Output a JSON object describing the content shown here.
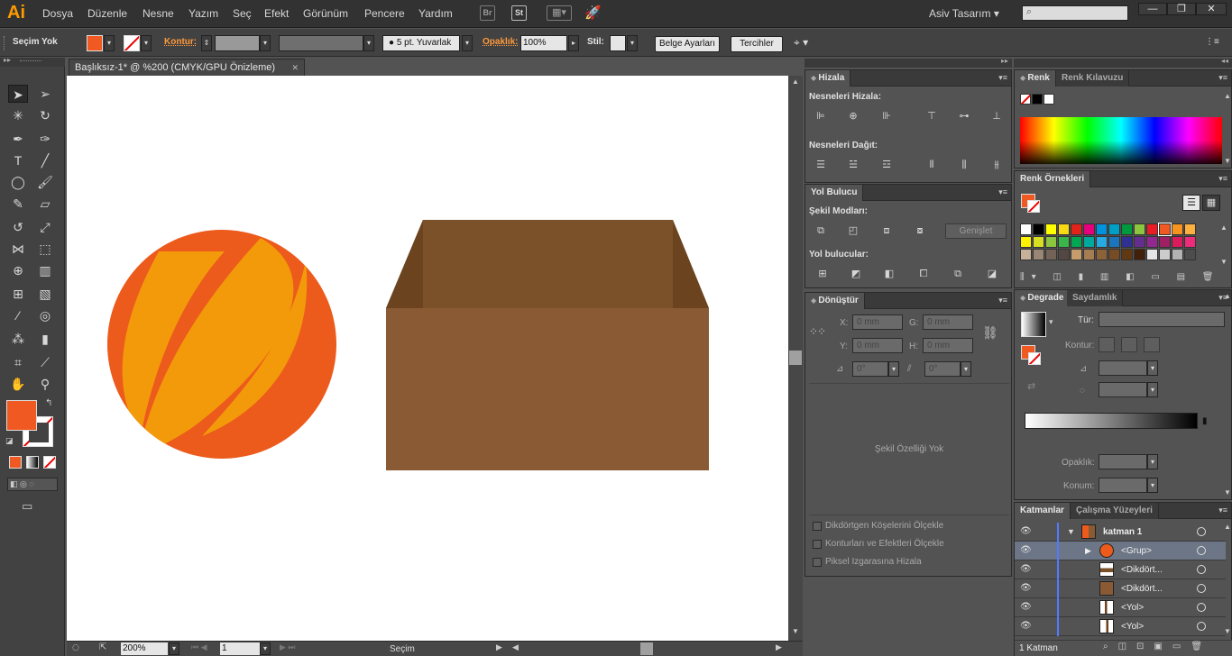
{
  "app": {
    "logo": "Ai"
  },
  "menu": [
    "Dosya",
    "Düzenle",
    "Nesne",
    "Yazım",
    "Seç",
    "Efekt",
    "Görünüm",
    "Pencere",
    "Yardım"
  ],
  "menubar_icons": {
    "bridge": "Br",
    "stock": "St"
  },
  "workspace": {
    "label": "Asiv Tasarım",
    "arrow": "▾"
  },
  "window_buttons": {
    "minimize": "—",
    "restore": "❐",
    "close": "✕"
  },
  "control": {
    "selection": "Seçim Yok",
    "stroke_label": "Kontur:",
    "brush": "5 pt. Yuvarlak",
    "opacity_label": "Opaklık:",
    "opacity": "100%",
    "style_label": "Stil:",
    "doc_setup": "Belge Ayarları",
    "prefs": "Tercihler"
  },
  "colors": {
    "fill": "#f05a22",
    "ball_orange": "#ec5a1c",
    "ball_yellow": "#f39a0a",
    "box_front": "#8a5a34",
    "box_inner": "#7a5128",
    "box_flap": "#6b431f"
  },
  "document": {
    "tab": "Başlıksız-1* @ %200 (CMYK/GPU Önizleme)",
    "close": "✕"
  },
  "status": {
    "zoom": "200%",
    "page": "1",
    "mode": "Seçim"
  },
  "align": {
    "tab": "Hizala",
    "align_objects": "Nesneleri Hizala:",
    "distribute_objects": "Nesneleri Dağıt:"
  },
  "pathfinder": {
    "tab": "Yol Bulucu",
    "shape_modes": "Şekil Modları:",
    "expand": "Genişlet",
    "pathfinders": "Yol bulucular:"
  },
  "transform": {
    "tab": "Dönüştür",
    "x_label": "X:",
    "x": "0 mm",
    "y_label": "Y:",
    "y": "0 mm",
    "g_label": "G:",
    "g": "0 mm",
    "h_label": "H:",
    "h": "0 mm",
    "rot": "0°",
    "shear": "0°",
    "no_props": "Şekil Özelliği Yok",
    "opt1": "Dikdörtgen Köşelerini Ölçekle",
    "opt2": "Konturları ve Efektleri Ölçekle",
    "opt3": "Piksel Izgarasına Hizala"
  },
  "color_panel": {
    "tab": "Renk",
    "tab2": "Renk Kılavuzu"
  },
  "swatches": {
    "tab": "Renk Örnekleri",
    "row1": [
      "#ffffff",
      "#000000",
      "#ffff00",
      "#f7d916",
      "#e2231a",
      "#e6007e",
      "#0093dd",
      "#00a0c6",
      "#009a3e",
      "#8cc63e",
      "#ec1c24",
      "#f05a22",
      "#f7941d",
      "#fbb040"
    ],
    "row2": [
      "#fff200",
      "#d7df23",
      "#8dc63f",
      "#39b54a",
      "#00a651",
      "#00a99d",
      "#27aae1",
      "#1c75bc",
      "#2e3192",
      "#662d91",
      "#92278f",
      "#9e1f63",
      "#da1c5c",
      "#ee2a7b"
    ],
    "row3": [
      "#c7b299",
      "#998675",
      "#736357",
      "#534741",
      "#c69c6d",
      "#a67c52",
      "#8c6239",
      "#754c24",
      "#603913",
      "#42210b",
      "#e6e6e6",
      "#cccccc",
      "#b3b3b3",
      "#4d4d4d"
    ]
  },
  "gradient": {
    "tab": "Degrade",
    "tab2": "Saydamlık",
    "type": "Tür:",
    "stroke": "Kontur:",
    "opacity": "Opaklık:",
    "location": "Konum:"
  },
  "layers": {
    "tab": "Katmanlar",
    "tab2": "Çalışma Yüzeyleri",
    "rows": [
      {
        "name": "katman 1",
        "level": 0,
        "expanded": true
      },
      {
        "name": "<Grup>",
        "level": 1,
        "selected": true
      },
      {
        "name": "<Dikdört...",
        "level": 1
      },
      {
        "name": "<Dikdört...",
        "level": 1
      },
      {
        "name": "<Yol>",
        "level": 1
      },
      {
        "name": "<Yol>",
        "level": 1
      }
    ],
    "footer": "1 Katman"
  }
}
